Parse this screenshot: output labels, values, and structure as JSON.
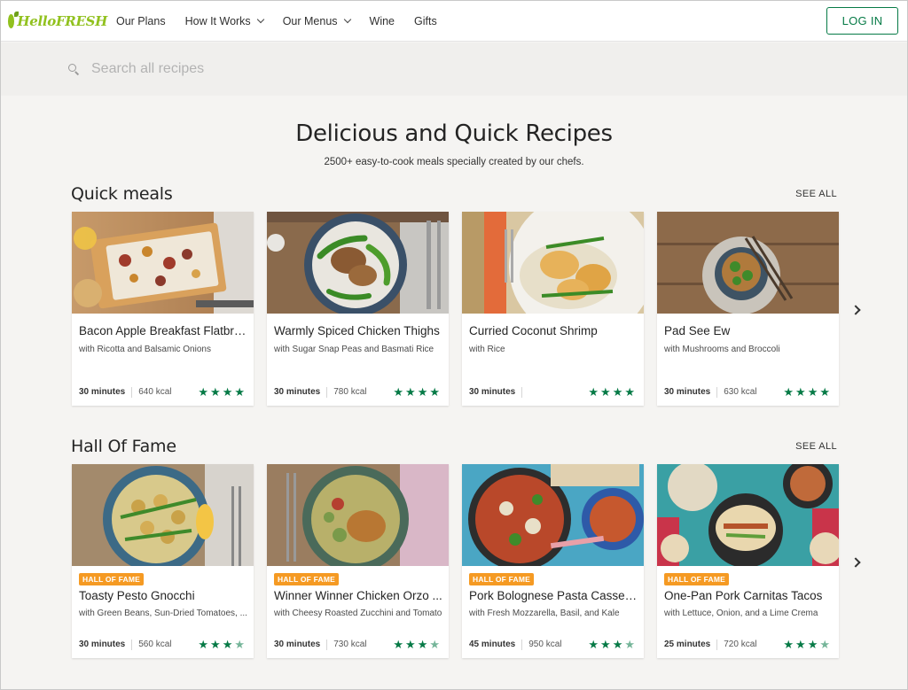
{
  "header": {
    "logo_text": "HelloFRESH",
    "nav": [
      {
        "label": "Our Plans",
        "dropdown": false
      },
      {
        "label": "How It Works",
        "dropdown": true
      },
      {
        "label": "Our Menus",
        "dropdown": true
      },
      {
        "label": "Wine",
        "dropdown": false
      },
      {
        "label": "Gifts",
        "dropdown": false
      }
    ],
    "login_label": "LOG IN"
  },
  "search": {
    "placeholder": "Search all recipes",
    "value": ""
  },
  "hero": {
    "title": "Delicious and Quick Recipes",
    "subtitle": "2500+ easy-to-cook meals specially created by our chefs."
  },
  "sections": [
    {
      "title": "Quick meals",
      "see_all": "SEE ALL",
      "cards": [
        {
          "title": "Bacon Apple Breakfast Flatbre...",
          "subtitle": "with Ricotta and Balsamic Onions",
          "time": "30 minutes",
          "kcal": "640 kcal",
          "rating": 4,
          "badge": ""
        },
        {
          "title": "Warmly Spiced Chicken Thighs",
          "subtitle": "with Sugar Snap Peas and Basmati Rice",
          "time": "30 minutes",
          "kcal": "780 kcal",
          "rating": 4,
          "badge": ""
        },
        {
          "title": "Curried Coconut Shrimp",
          "subtitle": "with Rice",
          "time": "30 minutes",
          "kcal": "",
          "rating": 4,
          "badge": ""
        },
        {
          "title": "Pad See Ew",
          "subtitle": "with Mushrooms and Broccoli",
          "time": "30 minutes",
          "kcal": "630 kcal",
          "rating": 4,
          "badge": ""
        }
      ]
    },
    {
      "title": "Hall Of Fame",
      "see_all": "SEE ALL",
      "cards": [
        {
          "title": "Toasty Pesto Gnocchi",
          "subtitle": "with Green Beans, Sun-Dried Tomatoes, ...",
          "time": "30 minutes",
          "kcal": "560 kcal",
          "rating": 3.5,
          "badge": "HALL OF FAME"
        },
        {
          "title": "Winner Winner Chicken Orzo ...",
          "subtitle": "with Cheesy Roasted Zucchini and Tomato",
          "time": "30 minutes",
          "kcal": "730 kcal",
          "rating": 3.5,
          "badge": "HALL OF FAME"
        },
        {
          "title": "Pork Bolognese Pasta Cassero...",
          "subtitle": "with Fresh Mozzarella, Basil, and Kale",
          "time": "45 minutes",
          "kcal": "950 kcal",
          "rating": 3.5,
          "badge": "HALL OF FAME"
        },
        {
          "title": "One-Pan Pork Carnitas Tacos",
          "subtitle": "with Lettuce, Onion, and a Lime Crema",
          "time": "25 minutes",
          "kcal": "720 kcal",
          "rating": 3.5,
          "badge": "HALL OF FAME"
        }
      ]
    }
  ],
  "colors": {
    "brand_green": "#91c11e",
    "accent_green": "#067a46",
    "badge_orange": "#f59a23"
  },
  "icons": {
    "search": "search-icon",
    "next": "chevron-right-icon",
    "dropdown": "chevron-down-icon"
  }
}
